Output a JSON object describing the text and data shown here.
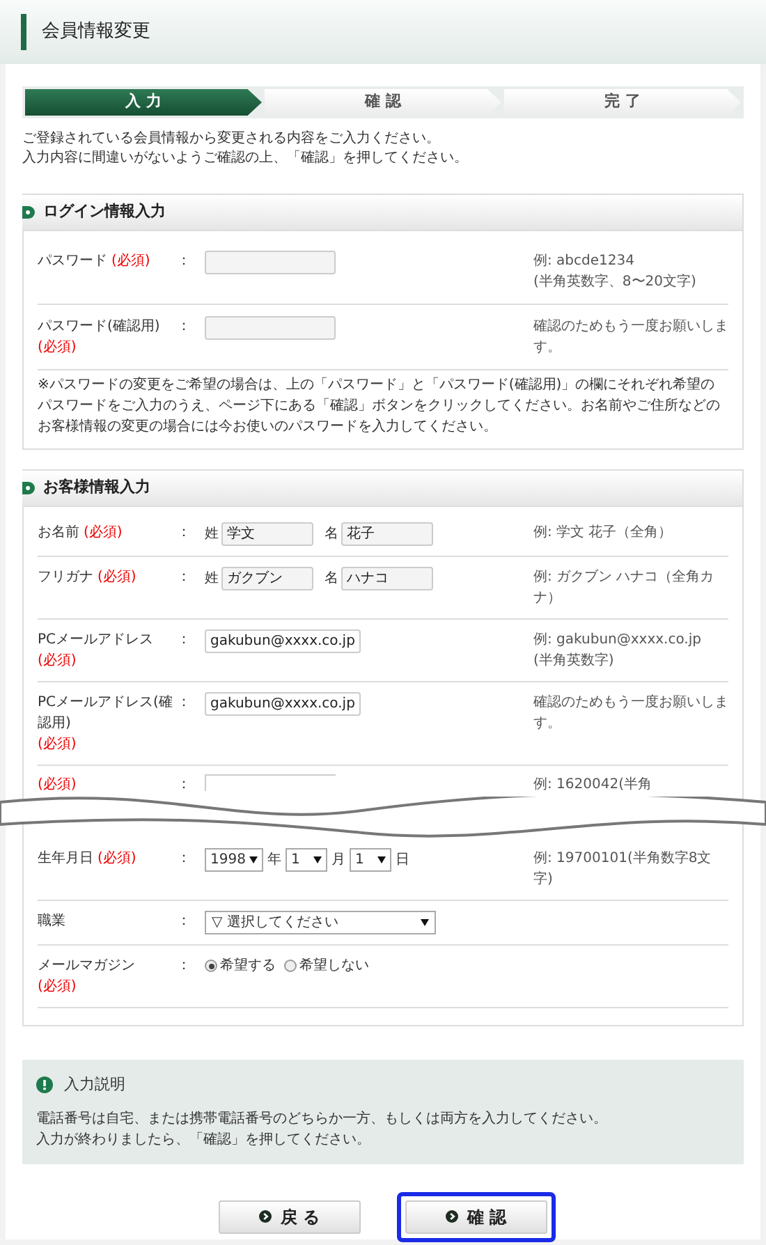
{
  "page_title": "会員情報変更",
  "steps": [
    {
      "label": "入 力",
      "selected": true
    },
    {
      "label": "確 認",
      "selected": false
    },
    {
      "label": "完 了",
      "selected": false
    }
  ],
  "intro": [
    "ご登録されている会員情報から変更される内容をご入力ください。",
    "入力内容に間違いがないようご確認の上、「確認」を押してください。"
  ],
  "login_section": {
    "title": "ログイン情報入力",
    "rows": [
      {
        "label": "パスワード",
        "required": "(必須)",
        "colon": "：",
        "hint": [
          "例: abcde1234",
          "(半角英数字、8〜20文字)"
        ]
      },
      {
        "label": "パスワード(確認用)",
        "required": "(必須)",
        "colon": "：",
        "hint": [
          "確認のためもう一度お願いします。"
        ]
      }
    ],
    "note": "※パスワードの変更をご希望の場合は、上の「パスワード」と「パスワード(確認用)」の欄にそれぞれ希望のパスワードをご入力のうえ、ページ下にある「確認」ボタンをクリックしてください。お名前やご住所などのお客様情報の変更の場合には今お使いのパスワードを入力してください。"
  },
  "customer_section": {
    "title": "お客様情報入力",
    "rows": [
      {
        "kind": "name",
        "label": "お名前",
        "required": "(必須)",
        "colon": "：",
        "fields": [
          {
            "prefix": "姓",
            "value": "学文"
          },
          {
            "prefix": "名",
            "value": "花子"
          }
        ],
        "hint": [
          "例: 学文 花子（全角）"
        ]
      },
      {
        "kind": "name",
        "label": "フリガナ",
        "required": "(必須)",
        "colon": "：",
        "fields": [
          {
            "prefix": "姓",
            "value": "ガクブン"
          },
          {
            "prefix": "名",
            "value": "ハナコ"
          }
        ],
        "hint": [
          "例: ガクブン ハナコ（全角カナ）"
        ]
      },
      {
        "kind": "text",
        "label": "PCメールアドレス",
        "required": "(必須)",
        "colon": "：",
        "value": "gakubun@xxxx.co.jp",
        "hint": [
          "例: gakubun@xxxx.co.jp",
          "(半角英数字)"
        ]
      },
      {
        "kind": "text",
        "label": "PCメールアドレス(確認用)",
        "required": "(必須)",
        "colon": "：",
        "value": "gakubun@xxxx.co.jp",
        "hint": [
          "確認のためもう一度お願いします。"
        ]
      },
      {
        "kind": "partial",
        "required": "(必須)",
        "colon": "：",
        "hint": [
          "例: 1620042(半角"
        ]
      },
      {
        "kind": "date",
        "label": "生年月日",
        "required": "(必須)",
        "colon": "：",
        "selects": [
          {
            "value": "1998",
            "unit": "年"
          },
          {
            "value": "1",
            "unit": "月"
          },
          {
            "value": "1",
            "unit": "日"
          }
        ],
        "hint": [
          "例: 19700101(半角数字8文字)"
        ]
      },
      {
        "kind": "select",
        "label": "職業",
        "colon": "：",
        "value": "▽ 選択してください"
      },
      {
        "kind": "radio",
        "label": "メールマガジン",
        "required": "(必須)",
        "colon": "：",
        "options": [
          {
            "label": "希望する",
            "selected": true
          },
          {
            "label": "希望しない",
            "selected": false
          }
        ]
      }
    ]
  },
  "explanation": {
    "title": "入力説明",
    "lines": [
      "電話番号は自宅、または携帯電話番号のどちらか一方、もしくは両方を入力してください。",
      "入力が終わりましたら、「確認」を押してください。"
    ]
  },
  "buttons": [
    {
      "label": "戻 る",
      "highlighted": false
    },
    {
      "label": "確 認",
      "highlighted": true
    }
  ]
}
